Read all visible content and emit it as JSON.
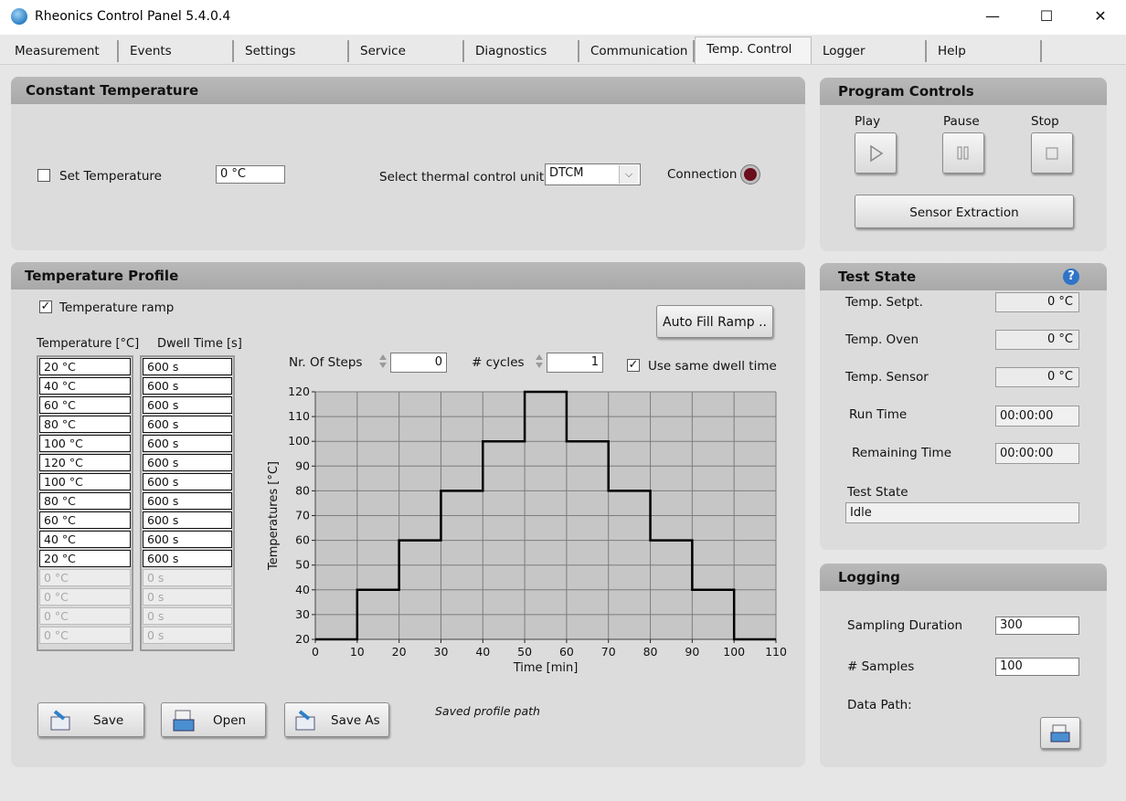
{
  "window": {
    "title": "Rheonics Control Panel 5.4.0.4",
    "minimize": "—",
    "maximize": "☐",
    "close": "✕"
  },
  "tabs": [
    {
      "label": "Measurement"
    },
    {
      "label": "Events"
    },
    {
      "label": "Settings"
    },
    {
      "label": "Service"
    },
    {
      "label": "Diagnostics"
    },
    {
      "label": "Communication"
    },
    {
      "label": "Temp. Control",
      "active": true
    },
    {
      "label": "Logger"
    },
    {
      "label": "Help"
    }
  ],
  "constant_temperature": {
    "title": "Constant Temperature",
    "set_temperature_label": "Set Temperature",
    "set_temperature_checked": false,
    "set_temperature_value": "0 °C",
    "thermal_unit_label": "Select thermal control unit",
    "thermal_unit_value": "DTCM",
    "connection_label": "Connection",
    "connection_color": "#6a0f1c"
  },
  "program_controls": {
    "title": "Program Controls",
    "play_label": "Play",
    "pause_label": "Pause",
    "stop_label": "Stop",
    "sensor_extraction_label": "Sensor Extraction"
  },
  "temperature_profile": {
    "title": "Temperature Profile",
    "ramp_label": "Temperature ramp",
    "ramp_checked": true,
    "auto_fill_label": "Auto Fill Ramp ..",
    "temp_col_header": "Temperature [°C]",
    "dwell_col_header": "Dwell Time [s]",
    "temperatures": [
      "20 °C",
      "40 °C",
      "60 °C",
      "80 °C",
      "100 °C",
      "120 °C",
      "100 °C",
      "80 °C",
      "60 °C",
      "40 °C",
      "20 °C",
      "0 °C",
      "0 °C",
      "0 °C",
      "0 °C"
    ],
    "dwell_times": [
      "600 s",
      "600 s",
      "600 s",
      "600 s",
      "600 s",
      "600 s",
      "600 s",
      "600 s",
      "600 s",
      "600 s",
      "600 s",
      "0 s",
      "0 s",
      "0 s",
      "0 s"
    ],
    "active_rows": 11,
    "nr_steps_label": "Nr. Of Steps",
    "nr_steps_value": "0",
    "cycles_label": "# cycles",
    "cycles_value": "1",
    "same_dwell_label": "Use same dwell time",
    "same_dwell_checked": true,
    "save_label": "Save",
    "open_label": "Open",
    "save_as_label": "Save As",
    "saved_path_label": "Saved profile path"
  },
  "chart_data": {
    "type": "line",
    "xlabel": "Time [min]",
    "ylabel": "Temperatures [°C]",
    "xlim": [
      0,
      110
    ],
    "ylim": [
      20,
      120
    ],
    "xticks": [
      0,
      10,
      20,
      30,
      40,
      50,
      60,
      70,
      80,
      90,
      100,
      110
    ],
    "yticks": [
      20,
      30,
      40,
      50,
      60,
      70,
      80,
      90,
      100,
      110,
      120
    ],
    "grid": true,
    "series": [
      {
        "x": [
          0,
          10,
          10,
          20,
          20,
          30,
          30,
          40,
          40,
          50,
          50,
          60,
          60,
          70,
          70,
          80,
          80,
          90,
          90,
          100,
          100,
          110
        ],
        "y": [
          20,
          20,
          40,
          40,
          60,
          60,
          80,
          80,
          100,
          100,
          120,
          120,
          100,
          100,
          80,
          80,
          60,
          60,
          40,
          40,
          20,
          20
        ]
      }
    ]
  },
  "test_state": {
    "title": "Test State",
    "help_icon": "?",
    "setpt_label": "Temp. Setpt.",
    "setpt_value": "0 °C",
    "oven_label": "Temp. Oven",
    "oven_value": "0 °C",
    "sensor_label": "Temp. Sensor",
    "sensor_value": "0 °C",
    "run_time_label": "Run Time",
    "run_time_value": "00:00:00",
    "remaining_label": "Remaining Time",
    "remaining_value": "00:00:00",
    "state_label": "Test State",
    "state_value": "Idle"
  },
  "logging": {
    "title": "Logging",
    "sampling_label": "Sampling Duration",
    "sampling_value": "300",
    "samples_label": "# Samples",
    "samples_value": "100",
    "data_path_label": "Data Path:"
  }
}
